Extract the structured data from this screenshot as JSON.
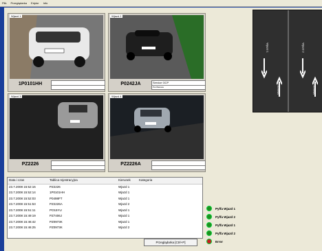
{
  "menu": [
    "Plik",
    "Przeglądarka",
    "Edytor",
    "Info"
  ],
  "cameras": [
    {
      "title": "Wjazd 1",
      "plate": "1P0101HH",
      "info1": "",
      "info2": ""
    },
    {
      "title": "Wjazd 2",
      "plate": "P0242JA",
      "info1": "Service GCP",
      "info2": "Pol.Warsaw"
    },
    {
      "title": "Wjazd 3",
      "plate": "PZ2226",
      "info1": "",
      "info2": ""
    },
    {
      "title": "Wjazd 4",
      "plate": "PZ2226A",
      "info1": "",
      "info2": ""
    }
  ],
  "table": {
    "headers": [
      "Data i czas",
      "Tablica rejestracyjna",
      "Kierunek",
      "Kategoria"
    ],
    "rows": [
      [
        "23.7.2008 15:52:16",
        "PZ2226",
        "Wjazd 1",
        ""
      ],
      [
        "23.7.2008 15:52:14",
        "1P0101HH",
        "Wjazd 1",
        ""
      ],
      [
        "23.7.2008 15:52:03",
        "P0498FT",
        "Wjazd 1",
        ""
      ],
      [
        "23.7.2008 15:51:53",
        "PZ2226A",
        "Wjazd 2",
        ""
      ],
      [
        "23.7.2008 15:51:11",
        "PO15YU",
        "Wjazd 1",
        ""
      ],
      [
        "23.7.2008 15:49:19",
        "PZ7406J",
        "Wjazd 1",
        ""
      ],
      [
        "23.7.2008 15:46:42",
        "PZ0973K",
        "Wjazd 1",
        ""
      ],
      [
        "23.7.2008 15:46:25",
        "PZ0973K",
        "Wjazd 2",
        ""
      ]
    ]
  },
  "button_label": "Przeglądarka [Ctrl+P]",
  "legend": [
    {
      "label": "Pyffa Wjazd 1",
      "color": "#1f8f1f"
    },
    {
      "label": "Pyffa Wjazd 2",
      "color": "#1f8f1f"
    },
    {
      "label": "Pyffa Wjazd 1",
      "color": "#1f8f1f"
    },
    {
      "label": "Pyffa Wjazd 2",
      "color": "#1f8f1f"
    },
    {
      "label": "Error",
      "color": "#c71f1f"
    }
  ],
  "road_labels": [
    "Wjazd 1",
    "Wjazd 2",
    "Wyjazd 1",
    "Wyjazd 2"
  ]
}
